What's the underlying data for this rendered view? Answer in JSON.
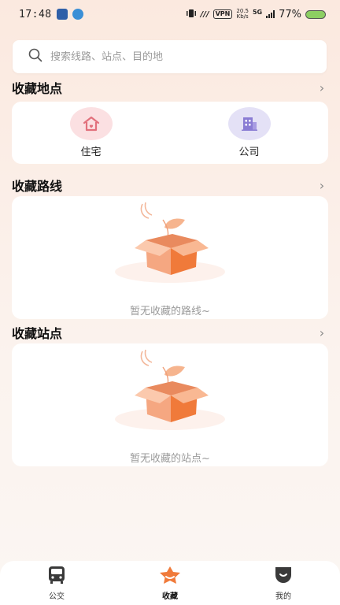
{
  "status_bar": {
    "time": "17:48",
    "vpn": "VPN",
    "speed_value": "20.5",
    "speed_unit": "Kb/s",
    "network": "5G",
    "battery": "77%"
  },
  "search": {
    "placeholder": "搜索线路、站点、目的地"
  },
  "favorite_places": {
    "title": "收藏地点",
    "items": [
      {
        "label": "住宅",
        "icon": "home-icon"
      },
      {
        "label": "公司",
        "icon": "building-icon"
      }
    ]
  },
  "favorite_routes": {
    "title": "收藏路线",
    "empty_text": "暂无收藏的路线~"
  },
  "favorite_stops": {
    "title": "收藏站点",
    "empty_text": "暂无收藏的站点~"
  },
  "bottom_nav": {
    "items": [
      {
        "label": "公交",
        "icon": "bus-icon",
        "active": false
      },
      {
        "label": "收藏",
        "icon": "star-icon",
        "active": true
      },
      {
        "label": "我的",
        "icon": "profile-icon",
        "active": false
      }
    ]
  },
  "colors": {
    "accent": "#f07a3a",
    "home_icon": "#e2707c",
    "work_icon": "#8a7cd4"
  }
}
